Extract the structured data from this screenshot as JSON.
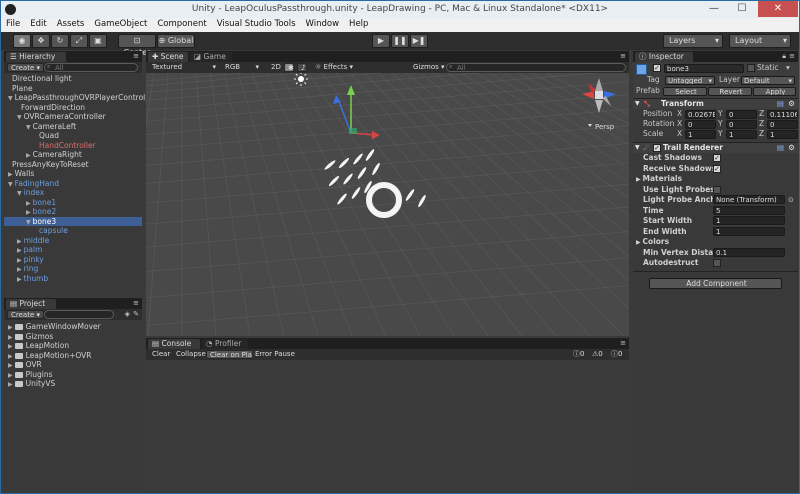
{
  "window": {
    "title": "Unity - LeapOculusPassthrough.unity - LeapDrawing - PC, Mac & Linux Standalone* <DX11>",
    "min": "—",
    "max": "☐",
    "close": "✕"
  },
  "menu": [
    "File",
    "Edit",
    "Assets",
    "GameObject",
    "Component",
    "Visual Studio Tools",
    "Window",
    "Help"
  ],
  "toolbar": {
    "pivot": "Center",
    "space": "Global",
    "layers": "Layers",
    "layout": "Layout"
  },
  "hierarchy": {
    "tab": "Hierarchy",
    "create": "Create",
    "search_placeholder": "All",
    "items": [
      {
        "label": "Directional light",
        "indent": 0,
        "tri": "",
        "color": ""
      },
      {
        "label": "Plane",
        "indent": 0,
        "tri": "",
        "color": ""
      },
      {
        "label": "LeapPassthroughOVRPlayerController",
        "indent": 0,
        "tri": "▼",
        "color": ""
      },
      {
        "label": "ForwardDirection",
        "indent": 1,
        "tri": "",
        "color": ""
      },
      {
        "label": "OVRCameraController",
        "indent": 1,
        "tri": "▼",
        "color": ""
      },
      {
        "label": "CameraLeft",
        "indent": 2,
        "tri": "▼",
        "color": ""
      },
      {
        "label": "Quad",
        "indent": 3,
        "tri": "",
        "color": ""
      },
      {
        "label": "HandController",
        "indent": 3,
        "tri": "",
        "color": "red"
      },
      {
        "label": "CameraRight",
        "indent": 2,
        "tri": "▶",
        "color": ""
      },
      {
        "label": "PressAnyKeyToReset",
        "indent": 0,
        "tri": "",
        "color": ""
      },
      {
        "label": "Walls",
        "indent": 0,
        "tri": "▶",
        "color": ""
      },
      {
        "label": "FadingHand",
        "indent": 0,
        "tri": "▼",
        "color": "blue"
      },
      {
        "label": "index",
        "indent": 1,
        "tri": "▼",
        "color": "blue"
      },
      {
        "label": "bone1",
        "indent": 2,
        "tri": "▶",
        "color": "blue"
      },
      {
        "label": "bone2",
        "indent": 2,
        "tri": "▶",
        "color": "blue"
      },
      {
        "label": "bone3",
        "indent": 2,
        "tri": "▼",
        "color": "blue",
        "selected": true
      },
      {
        "label": "capsule",
        "indent": 3,
        "tri": "",
        "color": "blue"
      },
      {
        "label": "middle",
        "indent": 1,
        "tri": "▶",
        "color": "blue"
      },
      {
        "label": "palm",
        "indent": 1,
        "tri": "▶",
        "color": "blue"
      },
      {
        "label": "pinky",
        "indent": 1,
        "tri": "▶",
        "color": "blue"
      },
      {
        "label": "ring",
        "indent": 1,
        "tri": "▶",
        "color": "blue"
      },
      {
        "label": "thumb",
        "indent": 1,
        "tri": "▶",
        "color": "blue"
      }
    ]
  },
  "project": {
    "tab": "Project",
    "create": "Create",
    "folders": [
      "GameWindowMover",
      "Gizmos",
      "LeapMotion",
      "LeapMotion+OVR",
      "OVR",
      "Plugins",
      "UnityVS"
    ]
  },
  "scene": {
    "tabs": [
      "Scene",
      "Game"
    ],
    "shading": "Textured",
    "render": "RGB",
    "mode2d": "2D",
    "effects": "Effects",
    "gizmos": "Gizmos",
    "search_placeholder": "All",
    "persp": "Persp"
  },
  "console": {
    "tabs": [
      "Console",
      "Profiler"
    ],
    "buttons": [
      "Clear",
      "Collapse",
      "Clear on Play",
      "Error Pause"
    ],
    "counts": [
      "0",
      "0",
      "0"
    ]
  },
  "inspector": {
    "tab": "Inspector",
    "object_name": "bone3",
    "static_label": "Static",
    "tag_label": "Tag",
    "tag_value": "Untagged",
    "layer_label": "Layer",
    "layer_value": "Default",
    "prefab_label": "Prefab",
    "prefab_buttons": [
      "Select",
      "Revert",
      "Apply"
    ],
    "transform": {
      "title": "Transform",
      "position": {
        "label": "Position",
        "x": "0.0267E",
        "y": "0",
        "z": "0.11106"
      },
      "rotation": {
        "label": "Rotation",
        "x": "0",
        "y": "0",
        "z": "0"
      },
      "scale": {
        "label": "Scale",
        "x": "1",
        "y": "1",
        "z": "1"
      }
    },
    "trail": {
      "title": "Trail Renderer",
      "props": [
        {
          "label": "Cast Shadows",
          "kind": "check",
          "value": "✓"
        },
        {
          "label": "Receive Shadows",
          "kind": "check",
          "value": "✓"
        },
        {
          "label": "Materials",
          "kind": "fold",
          "value": ""
        },
        {
          "label": "Use Light Probes",
          "kind": "check",
          "value": ""
        },
        {
          "label": "Light Probe Ancho",
          "kind": "field",
          "value": "None (Transform)"
        },
        {
          "label": "Time",
          "kind": "field",
          "value": "5"
        },
        {
          "label": "Start Width",
          "kind": "field",
          "value": "1"
        },
        {
          "label": "End Width",
          "kind": "field",
          "value": "1"
        },
        {
          "label": "Colors",
          "kind": "fold",
          "value": ""
        },
        {
          "label": "Min Vertex Distan",
          "kind": "field",
          "value": "0.1"
        },
        {
          "label": "Autodestruct",
          "kind": "check",
          "value": ""
        }
      ]
    },
    "add_component": "Add Component"
  }
}
